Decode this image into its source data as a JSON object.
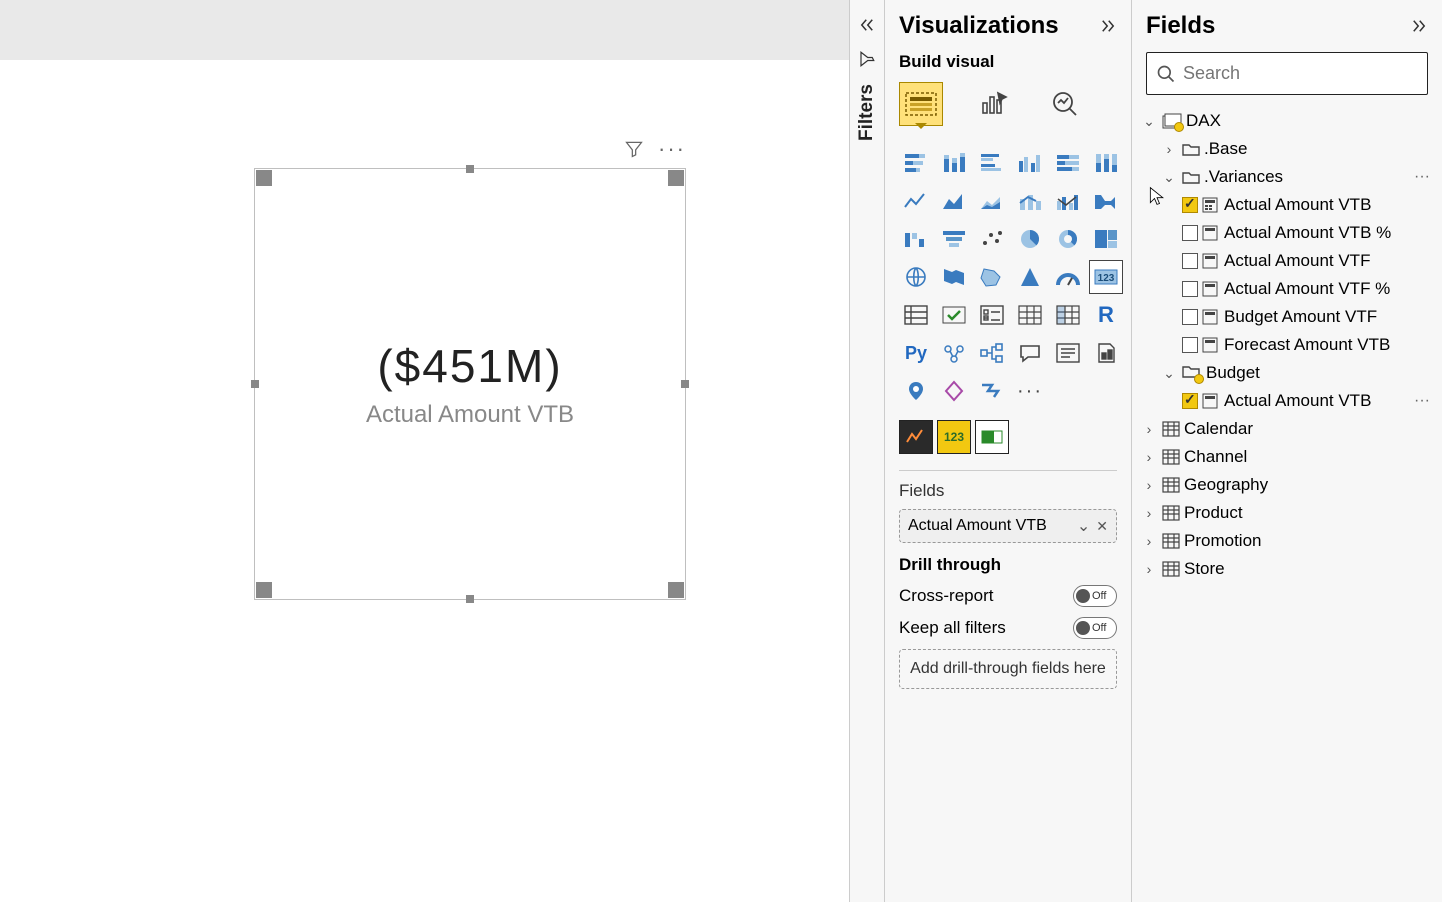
{
  "visualizations": {
    "title": "Visualizations",
    "build_label": "Build visual",
    "fields_label": "Fields",
    "field_chip": "Actual Amount VTB",
    "drill": {
      "title": "Drill through",
      "cross_report": "Cross-report",
      "cross_report_state": "Off",
      "keep_filters": "Keep all filters",
      "keep_filters_state": "Off",
      "drop_hint": "Add drill-through fields here"
    }
  },
  "filters": {
    "label": "Filters"
  },
  "fields_pane": {
    "title": "Fields",
    "search_placeholder": "Search",
    "tables": {
      "dax": "DAX",
      "base": ".Base",
      "variances": ".Variances",
      "budget": "Budget",
      "calendar": "Calendar",
      "channel": "Channel",
      "geography": "Geography",
      "product": "Product",
      "promotion": "Promotion",
      "store": "Store"
    },
    "measures": {
      "vtb": "Actual Amount VTB",
      "vtb_pct": "Actual Amount VTB %",
      "vtf": "Actual Amount VTF",
      "vtf_pct": "Actual Amount VTF %",
      "budget_vtf": "Budget Amount VTF",
      "forecast_vtb": "Forecast Amount VTB",
      "budget_vtb": "Actual Amount VTB"
    }
  },
  "card": {
    "value": "($451M)",
    "label": "Actual Amount VTB"
  },
  "viz_glyphs": {
    "r": "R",
    "py": "Py",
    "card123": "123",
    "more": "···"
  }
}
